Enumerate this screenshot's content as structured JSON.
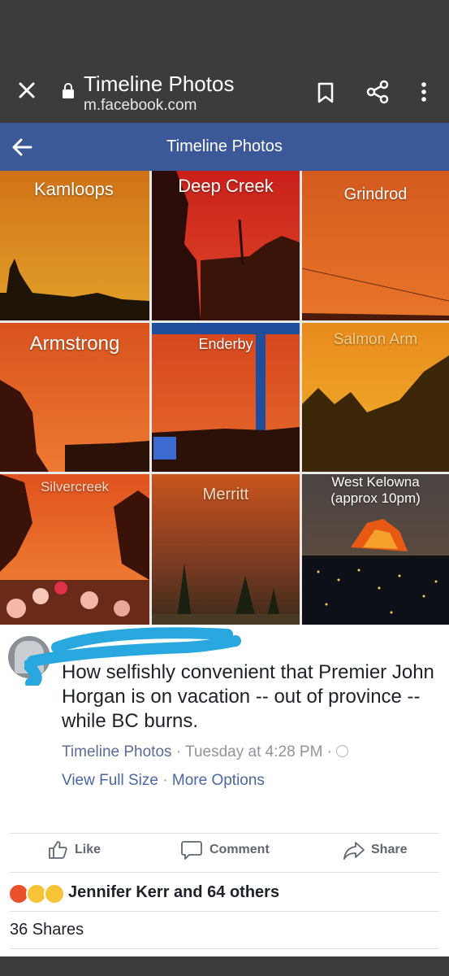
{
  "browser": {
    "title": "Timeline Photos",
    "url": "m.facebook.com",
    "icons": [
      "close-icon",
      "lock-icon",
      "bookmark-icon",
      "share-icon",
      "more-vert-icon"
    ]
  },
  "fb_header": {
    "title": "Timeline Photos",
    "back_icon": "arrow-left-icon",
    "color": "#3b5998"
  },
  "collage": {
    "tiles": [
      {
        "label": "Kamloops",
        "label2": ""
      },
      {
        "label": "Deep Creek",
        "label2": ""
      },
      {
        "label": "Grindrod",
        "label2": ""
      },
      {
        "label": "Armstrong",
        "label2": ""
      },
      {
        "label": "Enderby",
        "label2": ""
      },
      {
        "label": "Salmon Arm",
        "label2": ""
      },
      {
        "label": "Silvercreek",
        "label2": ""
      },
      {
        "label": "Merritt",
        "label2": ""
      },
      {
        "label": "West Kelowna",
        "label2": "(approx 10pm)"
      }
    ]
  },
  "post": {
    "message": "How selfishly convenient that Premier John Horgan is on vacation -- out of province -- while BC burns.",
    "source": "Timeline Photos",
    "time": "Tuesday at 4:28 PM",
    "privacy_icon": "globe-icon",
    "view_full_size": "View Full Size",
    "more_options": "More Options",
    "actions": {
      "like": "Like",
      "comment": "Comment",
      "share": "Share"
    },
    "reactions_text": "Jennifer Kerr and 64 others",
    "reaction_icons": [
      "angry-icon",
      "sad-icon",
      "wow-icon"
    ],
    "shares_text": "36 Shares"
  },
  "colors": {
    "facebook_blue": "#3b5998",
    "link": "#4b67a1",
    "scribble": "#29a8e0"
  }
}
